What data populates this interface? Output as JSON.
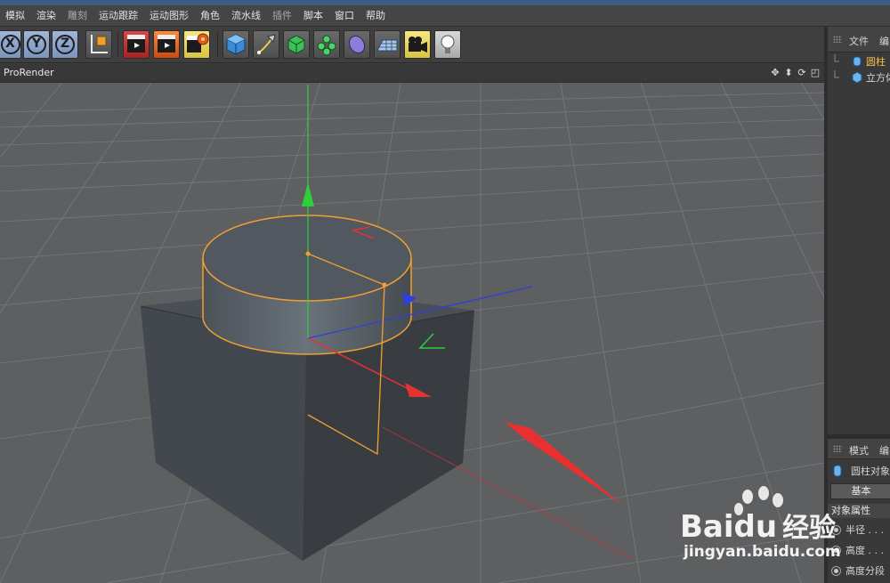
{
  "menubar": {
    "items": [
      "模拟",
      "渲染",
      "雕刻",
      "运动跟踪",
      "运动图形",
      "角色",
      "流水线",
      "插件",
      "脚本",
      "窗口",
      "帮助"
    ]
  },
  "toolbar": {
    "buttons": [
      "x-axis-lock",
      "y-axis-lock",
      "z-axis-lock",
      "world-coordinates",
      "render-view",
      "render-to-picture-viewer",
      "render-settings",
      "cube-primitive",
      "pen-spline",
      "subdivision-surface",
      "array-cloner",
      "deformer",
      "floor",
      "camera",
      "light"
    ],
    "axis_letters": [
      "X",
      "Y",
      "Z"
    ]
  },
  "viewport": {
    "renderer_label": "ProRender",
    "nav_icons": [
      "move-view-icon",
      "zoom-view-icon",
      "rotate-view-icon",
      "maximize-view-icon"
    ]
  },
  "object_manager": {
    "tabs": [
      "文件",
      "编"
    ],
    "objects": [
      {
        "name": "圆柱",
        "icon": "cylinder-icon",
        "selected": true,
        "color": "#f2c14a"
      },
      {
        "name": "立方体",
        "icon": "cube-icon",
        "selected": false,
        "color": "#d8d8d8"
      }
    ]
  },
  "attributes": {
    "tabs": [
      "模式",
      "编"
    ],
    "object_label": "圆柱对象",
    "tab_basic": "基本",
    "section_title": "对象属性",
    "rows": [
      "半径 . . .",
      "高度 . . .",
      "高度分段"
    ]
  },
  "watermark": {
    "brand": "Baidu",
    "brand_cn": "经验",
    "url": "jingyan.baidu.com"
  },
  "colors": {
    "accent_selected": "#f2c14a",
    "axis_x": "#e23333",
    "axis_y": "#2fcf3a",
    "axis_z": "#2c3fe0",
    "selection_outline": "#f0a030"
  }
}
